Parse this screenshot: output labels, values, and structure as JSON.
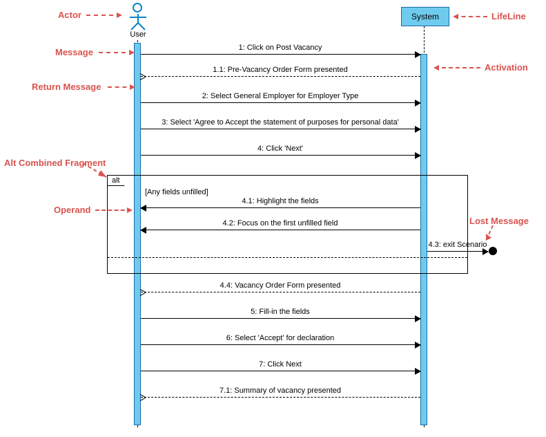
{
  "actor": {
    "name": "User"
  },
  "lifeline": {
    "name": "System"
  },
  "alt": {
    "label": "alt",
    "guard": "[Any fields unfilled]"
  },
  "messages": {
    "m1": "1: Click on Post Vacancy",
    "m11": "1.1: Pre-Vacancy Order Form presented",
    "m2": "2: Select General Employer for Employer Type",
    "m3": "3: Select 'Agree to Accept the statement of purposes for personal data'",
    "m4": "4: Click 'Next'",
    "m41": "4.1: Highlight the fields",
    "m42": "4.2: Focus on the first unfilled field",
    "m43": "4.3: exit Scenario",
    "m44": "4.4: Vacancy Order Form presented",
    "m5": "5: Fill-in the fields",
    "m6": "6: Select 'Accept' for declaration",
    "m7": "7: Click Next",
    "m71": "7.1: Summary of vacancy presented"
  },
  "annotations": {
    "actor": "Actor",
    "message": "Message",
    "returnMessage": "Return Message",
    "altFragment": "Alt Combined Fragment",
    "operand": "Operand",
    "lifeline": "LifeLine",
    "activation": "Activation",
    "lostMessage": "Lost Message"
  }
}
